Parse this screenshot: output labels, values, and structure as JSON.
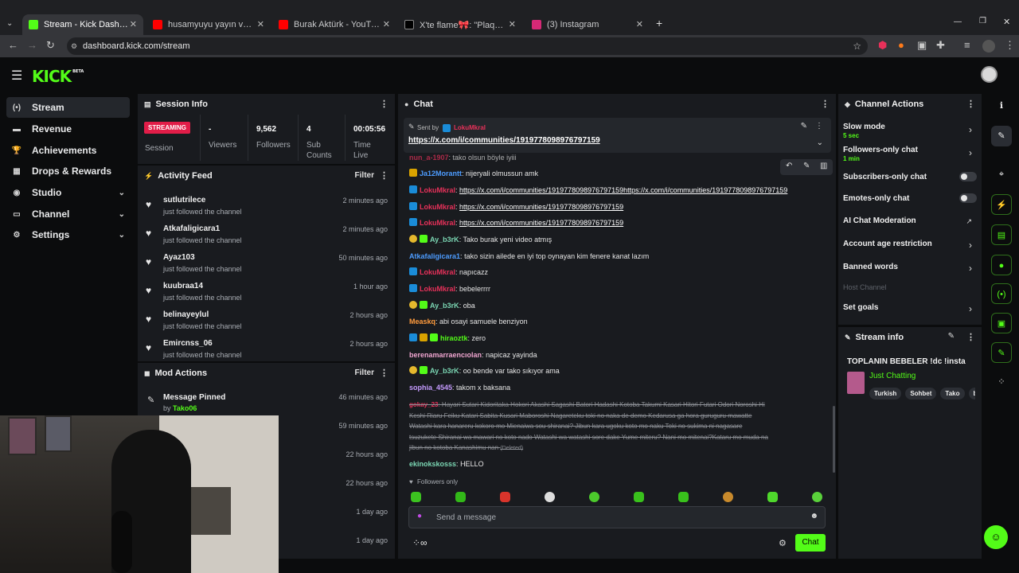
{
  "browser": {
    "tabs": [
      {
        "title": "Stream - Kick Dashboard",
        "active": true,
        "favicon_color": "#53fc18"
      },
      {
        "title": "husamyuyu yayın vakti 10 - YouTube",
        "favicon_color": "#ff0000"
      },
      {
        "title": "Burak Aktürk - YouTube",
        "favicon_color": "#ff0000"
      },
      {
        "title": "X'te flame🎀: \"Plaqueboymax e",
        "favicon_color": "#000000"
      },
      {
        "title": "(3) Instagram",
        "favicon_color": "#d62976"
      }
    ],
    "new_tab": "+",
    "url": "dashboard.kick.com/stream"
  },
  "app": {
    "logo": "KICK",
    "logo_badge": "BETA",
    "brand_color": "#53fc18"
  },
  "nav": [
    {
      "label": "Stream",
      "icon": "broadcast-icon",
      "glyph": "(•)",
      "active": true
    },
    {
      "label": "Revenue",
      "icon": "cash-icon",
      "glyph": "▬"
    },
    {
      "label": "Achievements",
      "icon": "trophy-icon",
      "glyph": "🏆"
    },
    {
      "label": "Drops & Rewards",
      "icon": "gift-icon",
      "glyph": "▦"
    },
    {
      "label": "Studio",
      "icon": "studio-icon",
      "glyph": "◉",
      "chevron": "⌄"
    },
    {
      "label": "Channel",
      "icon": "channel-icon",
      "glyph": "▭",
      "chevron": "⌄"
    },
    {
      "label": "Settings",
      "icon": "gear-icon",
      "glyph": "⚙",
      "chevron": "⌄"
    }
  ],
  "session": {
    "title": "Session Info",
    "status": "STREAMING",
    "status_label": "Session",
    "viewers_value": "-",
    "viewers_label": "Viewers",
    "followers_value": "9,562",
    "followers_label": "Followers",
    "subs_value": "4",
    "subs_label": "Sub Counts",
    "time_value": "00:05:56",
    "time_label": "Time Live"
  },
  "activity": {
    "title": "Activity Feed",
    "filter": "Filter",
    "items": [
      {
        "name": "sutlutrilece",
        "action": "just followed the channel",
        "time": "2 minutes ago"
      },
      {
        "name": "Atkafaligicara1",
        "action": "just followed the channel",
        "time": "2 minutes ago"
      },
      {
        "name": "Ayaz103",
        "action": "just followed the channel",
        "time": "50 minutes ago"
      },
      {
        "name": "kuubraa14",
        "action": "just followed the channel",
        "time": "1 hour ago"
      },
      {
        "name": "belinayeylul",
        "action": "just followed the channel",
        "time": "2 hours ago"
      },
      {
        "name": "Emircnss_06",
        "action": "just followed the channel",
        "time": "2 hours ago"
      }
    ]
  },
  "mod": {
    "title": "Mod Actions",
    "filter": "Filter",
    "items": [
      {
        "action": "Message Pinned",
        "by_prefix": "by",
        "by": "Tako06",
        "time": "46 minutes ago"
      },
      {
        "time": "59 minutes ago"
      },
      {
        "time": "22 hours ago"
      },
      {
        "time": "22 hours ago"
      },
      {
        "time": "1 day ago"
      },
      {
        "time": "1 day ago"
      }
    ]
  },
  "chat": {
    "title": "Chat",
    "pinned_prefix": "Sent by",
    "pinned_user": "LokuMkral",
    "pinned_link": "https://x.com/i/communities/1919778098976797159",
    "partial_line_user": "nun_a-1907",
    "partial_line_text": ": tako olsun böyle iyiii",
    "messages": [
      {
        "badges": [
          "crown"
        ],
        "user": "Ja12Morantt",
        "color": "#4d9cff",
        "text": "nijeryali olmussun amk"
      },
      {
        "badges": [
          "mod"
        ],
        "user": "LokuMkral",
        "color": "#e8315a",
        "text": "https://x.com/i/communities/1919778098976797159https://x.com/i/communities/1919778098976797159",
        "is_link": true
      },
      {
        "badges": [
          "mod"
        ],
        "user": "LokuMkral",
        "color": "#e8315a",
        "text": "https://x.com/i/communities/1919778098976797159",
        "is_link": true
      },
      {
        "badges": [
          "mod"
        ],
        "user": "LokuMkral",
        "color": "#e8315a",
        "text": "https://x.com/i/communities/1919778098976797159",
        "is_link": true
      },
      {
        "badges": [
          "vip",
          "sub"
        ],
        "user": "Ay_b3rK",
        "color": "#7bd6b3",
        "text": "Tako burak yeni video atmış"
      },
      {
        "badges": [],
        "user": "Atkafaligicara1",
        "color": "#4d9cff",
        "text": "tako sizin ailede en iyi top oynayan kim fenere kanat lazım"
      },
      {
        "badges": [
          "mod"
        ],
        "user": "LokuMkral",
        "color": "#e8315a",
        "text": "napıcazz"
      },
      {
        "badges": [
          "mod"
        ],
        "user": "LokuMkral",
        "color": "#e8315a",
        "text": "bebelerrrr"
      },
      {
        "badges": [
          "vip",
          "sub"
        ],
        "user": "Ay_b3rK",
        "color": "#7bd6b3",
        "text": "oba"
      },
      {
        "badges": [],
        "user": "Measkq",
        "color": "#ff9b3d",
        "text": "abi osayi samuele benziyon"
      },
      {
        "badges": [
          "mod",
          "crown",
          "sub"
        ],
        "user": "hiraoztk",
        "color": "#53fc18",
        "text": "zero"
      },
      {
        "badges": [],
        "user": "berenamarraencıolan",
        "color": "#f0a5d0",
        "text": "napicaz yayinda"
      },
      {
        "badges": [
          "vip",
          "sub"
        ],
        "user": "Ay_b3rK",
        "color": "#7bd6b3",
        "text": "oo bende var tako sıkıyor ama"
      },
      {
        "badges": [],
        "user": "sophia_4545",
        "color": "#c59bff",
        "text": "takom x baksana"
      }
    ],
    "deleted": {
      "user": "gokay_23",
      "color": "#e8315a",
      "lines": [
        "Hayari Sutari Kidoritaka Hokori Akashi Sagashi Batori Hadashi Kotoba Takumi Kasari Hitori Futari Odori Noroshi Hi",
        "Keshi Riaru Feiku Katari Sabita Kusari Maboroshi Nagareteku toki no naka de demo Kedarusa ga hora guruguru mawatte",
        "Watashi kara hanareru kokoro mo Mienaiwa sou shiranai? Jibun kara ugoku koto mo naku Toki no sukima ni nagasare",
        "tsuzukete Shiranai wa mawari no koto nado Watashi wa watashi sore dake Yume miteru? Nani mo mitenai?Kataru mo muda na",
        "jibun no kotoba Kanashimu nan"
      ],
      "tag": "(Deleted)"
    },
    "last": {
      "user": "ekinokskosss",
      "color": "#7bd6b3",
      "text": "HELLO"
    },
    "followers_only": "Followers only",
    "input_placeholder": "Send a message",
    "send_button": "Chat"
  },
  "actions": {
    "title": "Channel Actions",
    "slow_mode": "Slow mode",
    "slow_mode_value": "5 sec",
    "followers_only": "Followers-only chat",
    "followers_only_value": "1 min",
    "subs_only": "Subscribers-only chat",
    "emotes_only": "Emotes-only chat",
    "ai_mod": "AI Chat Moderation",
    "account_age": "Account age restriction",
    "banned_words": "Banned words",
    "host_channel": "Host Channel",
    "set_goals": "Set goals"
  },
  "stream_info": {
    "title": "Stream info",
    "stream_title": "TOPLANIN BEBELER !dc !insta",
    "category": "Just Chatting",
    "tags": [
      "Turkish",
      "Sohbet",
      "Tako",
      "b"
    ]
  }
}
